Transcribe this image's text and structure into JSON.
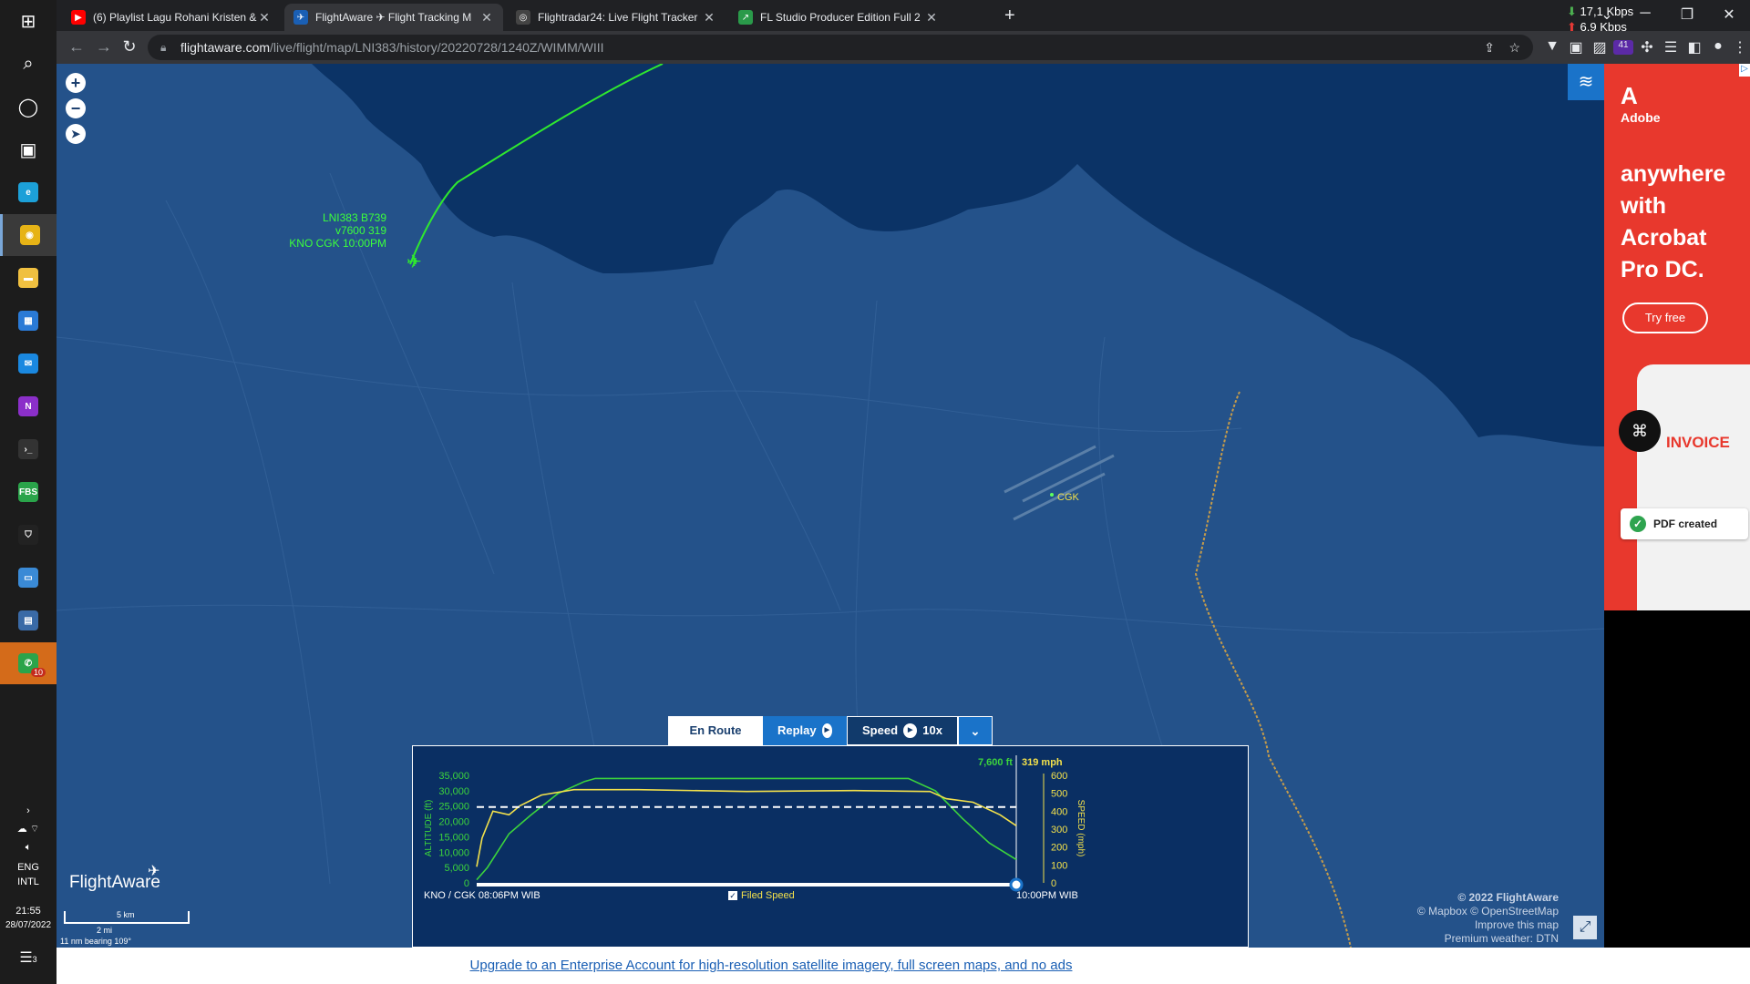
{
  "taskbar": {
    "items": [
      {
        "name": "start-button",
        "glyph": "⊞"
      },
      {
        "name": "search-icon",
        "glyph": "⌕"
      },
      {
        "name": "cortana-icon",
        "glyph": "◯"
      },
      {
        "name": "task-view-icon",
        "glyph": "▣"
      },
      {
        "name": "edge-icon",
        "glyph": "e",
        "color": "#1ca0d8"
      },
      {
        "name": "chrome-icon",
        "glyph": "◉",
        "color": "#e6b316"
      },
      {
        "name": "file-explorer-icon",
        "glyph": "▬",
        "color": "#f0c040"
      },
      {
        "name": "store-icon",
        "glyph": "▦",
        "color": "#2a7ad6"
      },
      {
        "name": "mail-icon",
        "glyph": "✉",
        "color": "#1a88e0"
      },
      {
        "name": "onenote-icon",
        "glyph": "N",
        "color": "#8b2fc9"
      },
      {
        "name": "terminal-icon",
        "glyph": "›_",
        "color": "#333333"
      },
      {
        "name": "fl-studio-icon",
        "glyph": "FBS",
        "color": "#2aa44a"
      },
      {
        "name": "security-icon",
        "glyph": "⛉",
        "color": "#222222"
      },
      {
        "name": "remote-desktop-icon",
        "glyph": "▭",
        "color": "#3a8ad6"
      },
      {
        "name": "control-panel-icon",
        "glyph": "▤",
        "color": "#3a6aa6"
      },
      {
        "name": "whatsapp-icon",
        "glyph": "✆",
        "color": "#2aa44a",
        "badge": "10"
      }
    ],
    "tray": {
      "language": "ENG",
      "layout": "INTL",
      "time": "21:55",
      "date": "28/07/2022",
      "notifications": "3"
    }
  },
  "tabs": [
    {
      "title": "(6) Playlist Lagu Rohani Kristen &",
      "favicon": "▶",
      "favcolor": "#ff0000",
      "active": false
    },
    {
      "title": "FlightAware ✈ Flight Tracking M",
      "favicon": "✈",
      "favcolor": "#1a5fb4",
      "active": true
    },
    {
      "title": "Flightradar24: Live Flight Tracker",
      "favicon": "◎",
      "favcolor": "#444444",
      "active": false
    },
    {
      "title": "FL Studio Producer Edition Full 2",
      "favicon": "↗",
      "favcolor": "#2a9a4a",
      "active": false
    }
  ],
  "net": {
    "down": "17,1 Kbps",
    "up": "6,9 Kbps"
  },
  "address": {
    "host": "flightaware.com",
    "path": "/live/flight/map/LNI383/history/20220728/1240Z/WIMM/WIII"
  },
  "extensions_badge": "41",
  "map": {
    "flight_label": {
      "line1": "LNI383 B739",
      "line2": "v7600 319",
      "line3": "KNO CGK 10:00PM"
    },
    "airport": "CGK"
  },
  "ad": {
    "brand": "Adobe",
    "headline": [
      "anywhere",
      "with",
      "Acrobat",
      "Pro DC."
    ],
    "cta": "Try free",
    "doc_title": "INVOICE",
    "toast": "PDF created"
  },
  "controls": {
    "en_route": "En Route",
    "replay": "Replay",
    "speed_label": "Speed",
    "speed_value": "10x"
  },
  "profile": {
    "altitude_readout": "7,600 ft",
    "speed_readout": "319 mph",
    "left_axis_title": "ALTITUDE (ft)",
    "right_axis_title": "SPEED (mph)",
    "alt_ticks": [
      "35,000",
      "30,000",
      "25,000",
      "20,000",
      "15,000",
      "10,000",
      "5,000",
      "0"
    ],
    "spd_ticks": [
      "600",
      "500",
      "400",
      "300",
      "200",
      "100",
      "0"
    ],
    "start_label": "KNO / CGK 08:06PM WIB",
    "end_label": "10:00PM WIB",
    "filed_speed": "Filed Speed"
  },
  "chart_data": {
    "type": "line",
    "x_unit": "fraction of flight timeline",
    "series": [
      {
        "axis": "ALTITUDE (ft)",
        "color": "#3cd43c",
        "x": [
          0,
          0.02,
          0.06,
          0.1,
          0.15,
          0.2,
          0.22,
          0.8,
          0.85,
          0.9,
          0.95,
          1.0
        ],
        "y": [
          1000,
          5000,
          16000,
          22000,
          29000,
          33000,
          34000,
          34000,
          30000,
          21000,
          13000,
          7600
        ]
      },
      {
        "axis": "SPEED (mph)",
        "color": "#f3e14b",
        "x": [
          0,
          0.01,
          0.03,
          0.06,
          0.08,
          0.12,
          0.18,
          0.3,
          0.5,
          0.7,
          0.84,
          0.87,
          0.92,
          0.97,
          1.0
        ],
        "y": [
          90,
          250,
          400,
          380,
          430,
          490,
          520,
          520,
          510,
          515,
          510,
          470,
          450,
          380,
          319
        ]
      },
      {
        "axis": "SPEED (mph)",
        "color": "#ffffff",
        "dashed": true,
        "x": [
          0,
          1
        ],
        "y": [
          423,
          423
        ]
      }
    ],
    "ylim_altitude": [
      0,
      35000
    ],
    "ylim_speed": [
      0,
      600
    ],
    "progress": 1.0
  },
  "attribution": [
    "© 2022 FlightAware",
    "© Mapbox © OpenStreetMap",
    "Improve this map",
    "Premium weather: DTN"
  ],
  "scale": {
    "km": "5 km",
    "mi": "2 mi",
    "bearing": "11 nm bearing 109°"
  },
  "logo": "FlightAware",
  "footer_link": "Upgrade to an Enterprise Account for high-resolution satellite imagery, full screen maps, and no ads"
}
